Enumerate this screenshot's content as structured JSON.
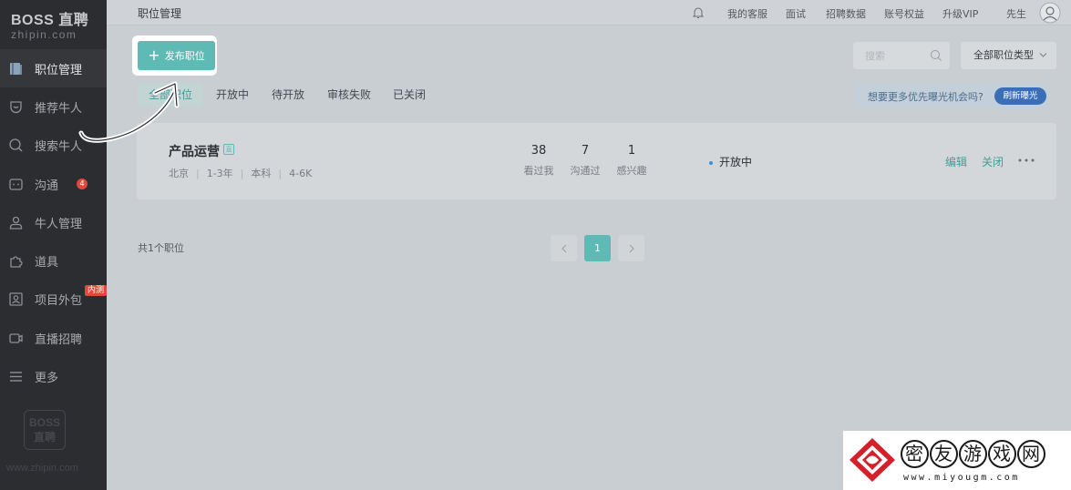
{
  "sidebar": {
    "logo_main": "BOSS 直聘",
    "logo_sub": "zhipin.com",
    "items": [
      {
        "label": "职位管理",
        "icon": "job-icon",
        "active": true
      },
      {
        "label": "推荐牛人",
        "icon": "shield-icon"
      },
      {
        "label": "搜索牛人",
        "icon": "search-icon"
      },
      {
        "label": "沟通",
        "icon": "chat-icon",
        "badge": "4"
      },
      {
        "label": "牛人管理",
        "icon": "person-icon"
      },
      {
        "label": "道具",
        "icon": "puzzle-icon"
      },
      {
        "label": "项目外包",
        "icon": "portrait-icon",
        "tag": "内测"
      },
      {
        "label": "直播招聘",
        "icon": "video-icon"
      },
      {
        "label": "更多",
        "icon": "menu-icon"
      }
    ],
    "watermark_logo": "BOSS 直聘",
    "footer_url": "www.zhipin.com"
  },
  "topbar": {
    "title": "职位管理",
    "links": [
      "我的客服",
      "面试",
      "招聘数据",
      "账号权益",
      "升级VIP",
      "先生"
    ]
  },
  "toolbar": {
    "publish_label": "发布职位",
    "search_placeholder": "搜索",
    "type_select": "全部职位类型"
  },
  "tabs": [
    "全部职位",
    "开放中",
    "待开放",
    "审核失败",
    "已关闭"
  ],
  "promo": {
    "text": "想要更多优先曝光机会吗?",
    "button": "刷新曝光"
  },
  "job": {
    "title": "产品运营",
    "tag": "直",
    "city": "北京",
    "experience": "1-3年",
    "degree": "本科",
    "salary": "4-6K",
    "stats": [
      {
        "value": "38",
        "label": "看过我"
      },
      {
        "value": "7",
        "label": "沟通过"
      },
      {
        "value": "1",
        "label": "感兴趣"
      }
    ],
    "status": "开放中",
    "actions": [
      "编辑",
      "关闭"
    ]
  },
  "pagination": {
    "total": "共1个职位",
    "current": "1"
  },
  "watermark": {
    "chars": [
      "密",
      "友",
      "游",
      "戏",
      "网"
    ],
    "url": "www.miyougm.com"
  },
  "colors": {
    "accent": "#5dbab5",
    "sidebar_bg": "#2b2d31",
    "badge": "#e0483d",
    "promo_button": "#3a6fb8"
  }
}
